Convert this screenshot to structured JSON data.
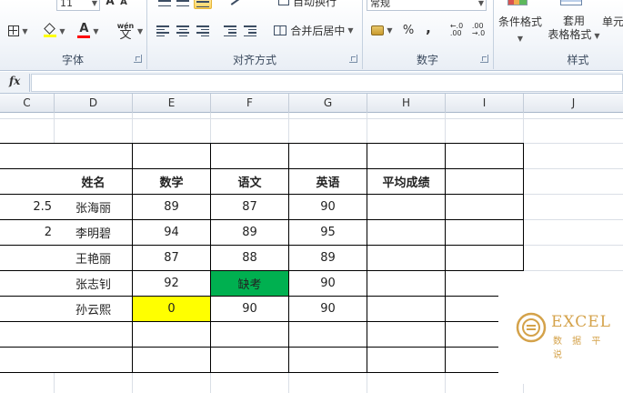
{
  "ribbon": {
    "font_size_value": "11",
    "number_format_value": "常规",
    "wrap_text_label": "自动换行",
    "merge_center_label": "合并后居中",
    "percent_label": "%",
    "comma_label": ",",
    "phonetic_label_top": "wén",
    "phonetic_label_bottom": "文",
    "conditional_format_label": "条件格式",
    "table_format_label_top": "套用",
    "table_format_label_bottom": "表格格式",
    "cell_styles_label": "单元",
    "groups": {
      "font": "字体",
      "alignment": "对齐方式",
      "number": "数字",
      "styles": "样式"
    },
    "colors": {
      "fill_color": "#ffff00",
      "font_color": "#ff0000"
    }
  },
  "formula_bar": {
    "fx_label": "fx",
    "value": ""
  },
  "columns": [
    "C",
    "D",
    "E",
    "F",
    "G",
    "H",
    "I",
    "J"
  ],
  "sheet": {
    "headers": [
      "姓名",
      "数学",
      "语文",
      "英语",
      "平均成绩"
    ],
    "rows": [
      {
        "name": "张海丽",
        "math": "89",
        "chinese": "87",
        "english": "90",
        "average": "",
        "left_value": "2.5"
      },
      {
        "name": "李明碧",
        "math": "94",
        "chinese": "89",
        "english": "95",
        "average": "",
        "left_value": "2"
      },
      {
        "name": "王艳丽",
        "math": "87",
        "chinese": "88",
        "english": "89",
        "average": "",
        "left_value": ""
      },
      {
        "name": "张志钊",
        "math": "92",
        "chinese": "缺考",
        "english": "90",
        "average": "",
        "left_value": ""
      },
      {
        "name": "孙云熙",
        "math": "0",
        "chinese": "90",
        "english": "90",
        "average": "",
        "left_value": ""
      }
    ],
    "highlight_colors": {
      "absent": "#00b050",
      "zero_score": "#ffff00"
    }
  },
  "watermark": {
    "title": "EXCEL",
    "subtitle": "数 据 平 说"
  }
}
